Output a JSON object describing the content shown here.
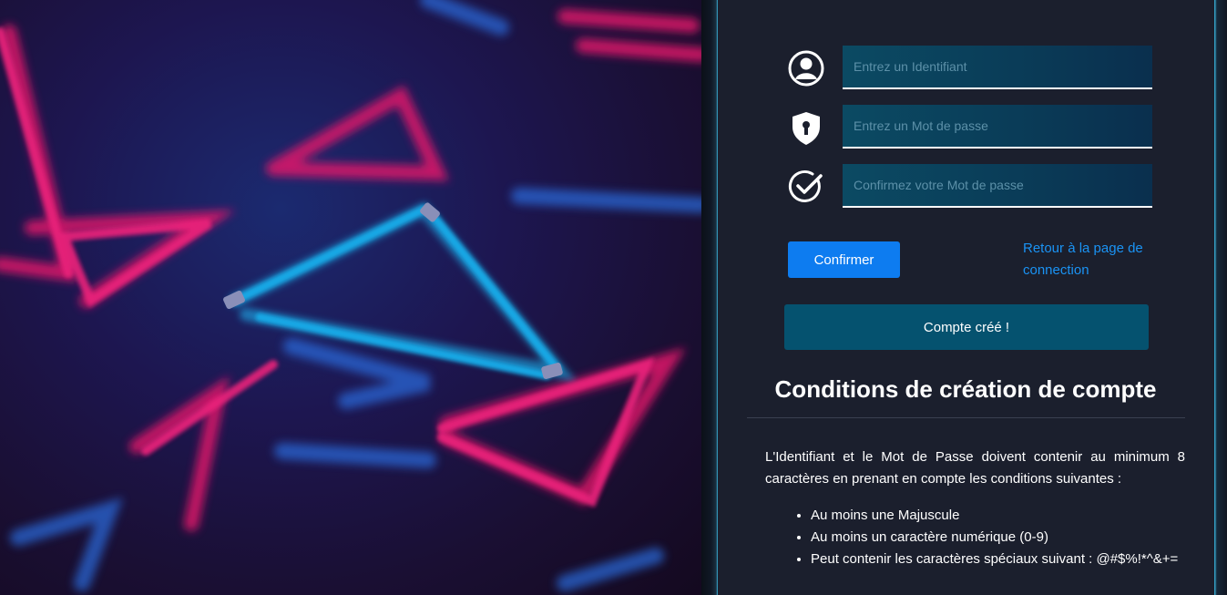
{
  "form": {
    "username": {
      "placeholder": "Entrez un Identifiant",
      "value": "",
      "icon": "user-circle-icon"
    },
    "password": {
      "placeholder": "Entrez un Mot de passe",
      "value": "",
      "icon": "shield-lock-icon"
    },
    "confirm_password": {
      "placeholder": "Confirmez votre Mot de passe",
      "value": "",
      "icon": "check-circle-icon"
    },
    "confirm_label": "Confirmer",
    "back_link_label": "Retour à la page de connection"
  },
  "status": {
    "message": "Compte créé !"
  },
  "conditions": {
    "title": "Conditions de création de compte",
    "intro": "L'Identifiant et le Mot de Passe doivent contenir au minimum 8 caractères en prenant en compte les conditions suivantes :",
    "items": [
      "Au moins une Majuscule",
      "Au moins un caractère numérique (0-9)",
      "Peut contenir les caractères spéciaux suivant : @#$%!*^&+="
    ]
  },
  "colors": {
    "accent_button": "#0d7cf0",
    "link": "#1a93f4",
    "status_box": "#05526f",
    "panel_background": "#1b1f2d"
  }
}
